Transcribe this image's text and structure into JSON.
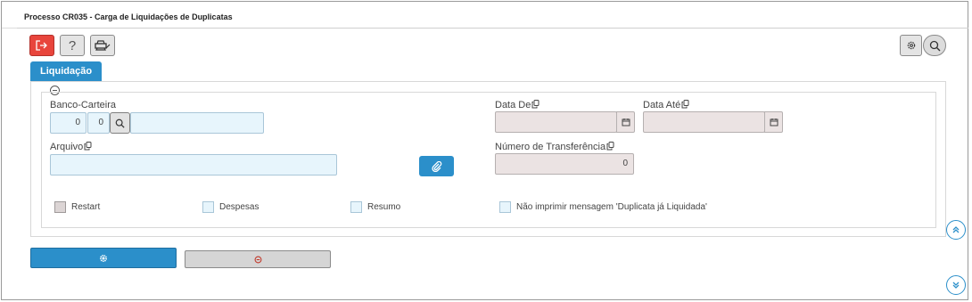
{
  "window": {
    "title": "Processo CR035 - Carga de Liquidações de Duplicatas"
  },
  "toolbar": {
    "exit_icon": "exit-icon",
    "help_label": "?",
    "print_icon": "print-icon",
    "settings_icon": "gear-icon",
    "search_icon": "search-icon"
  },
  "tabs": [
    {
      "label": "Liquidação"
    }
  ],
  "form": {
    "banco_carteira": {
      "label": "Banco-Carteira",
      "banco": "0",
      "carteira": "0",
      "descricao": ""
    },
    "data_de": {
      "label": "Data De",
      "value": ""
    },
    "data_ate": {
      "label": "Data Até",
      "value": ""
    },
    "arquivo": {
      "label": "Arquivo",
      "value": ""
    },
    "numero_transferencia": {
      "label": "Número de Transferência",
      "value": "0"
    },
    "checkboxes": [
      {
        "label": "Restart",
        "checked": false
      },
      {
        "label": "Despesas",
        "checked": false
      },
      {
        "label": "Resumo",
        "checked": false
      },
      {
        "label": "Não imprimir mensagem 'Duplicata já Liquidada'",
        "checked": false
      }
    ]
  },
  "actions": {
    "execute_icon": "gear-icon",
    "cancel_icon": "cancel-circle-icon"
  },
  "colors": {
    "accent": "#2b8fca",
    "exit": "#e8453c",
    "input_bg": "#e7f5fc",
    "readonly_bg": "#ebe3e3"
  }
}
